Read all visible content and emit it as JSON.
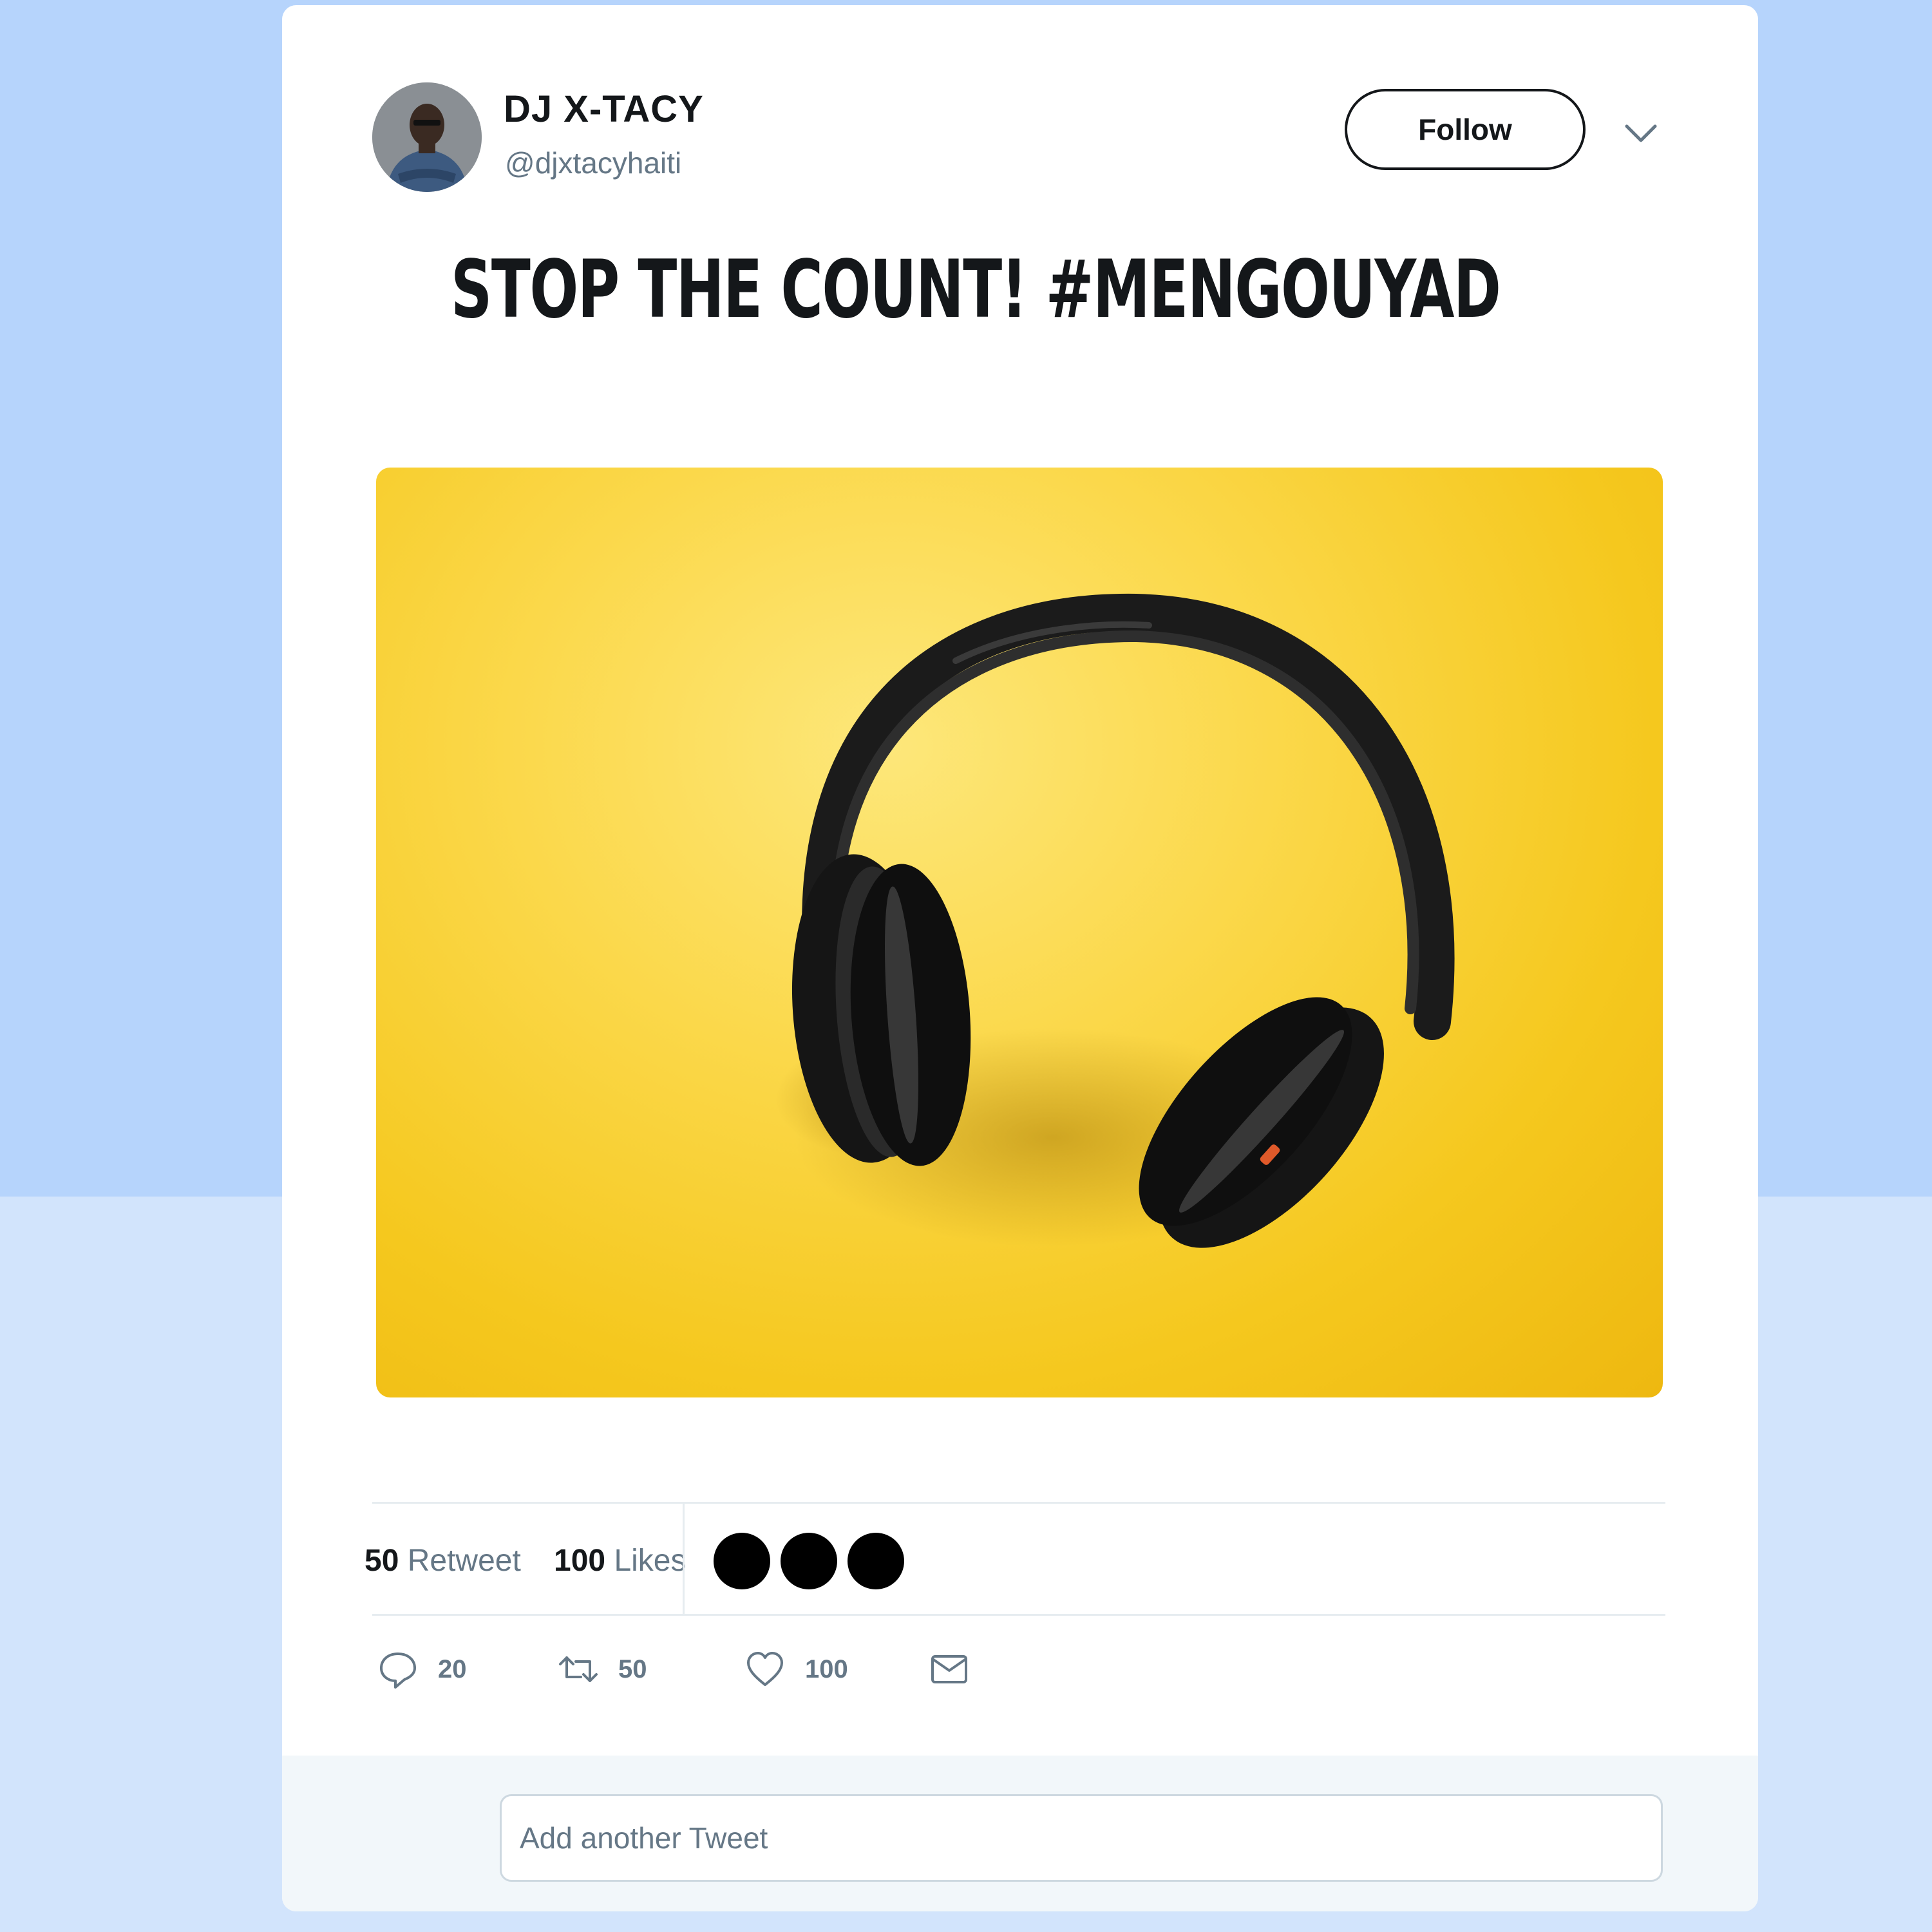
{
  "tweet": {
    "display_name": "DJ X-TACY",
    "handle": "@djxtacyhaiti",
    "follow_label": "Follow",
    "text": "STOP THE COUNT! #MENGOUYAD"
  },
  "stats": {
    "retweet_count": "50",
    "retweet_label": "Retweet",
    "likes_count": "100",
    "likes_label": "Likes"
  },
  "actions": {
    "reply_count": "20",
    "retweet_count": "50",
    "like_count": "100"
  },
  "reply": {
    "placeholder": "Add another Tweet"
  },
  "icons": [
    "avatar-photo",
    "chevron-down-icon",
    "reply-icon",
    "retweet-icon",
    "heart-icon",
    "mail-icon"
  ],
  "colors": {
    "background": "#b6d4fc",
    "card": "#ffffff",
    "text": "#14171a",
    "secondary_text": "#657786",
    "media_yellow": "#f5c81e"
  }
}
